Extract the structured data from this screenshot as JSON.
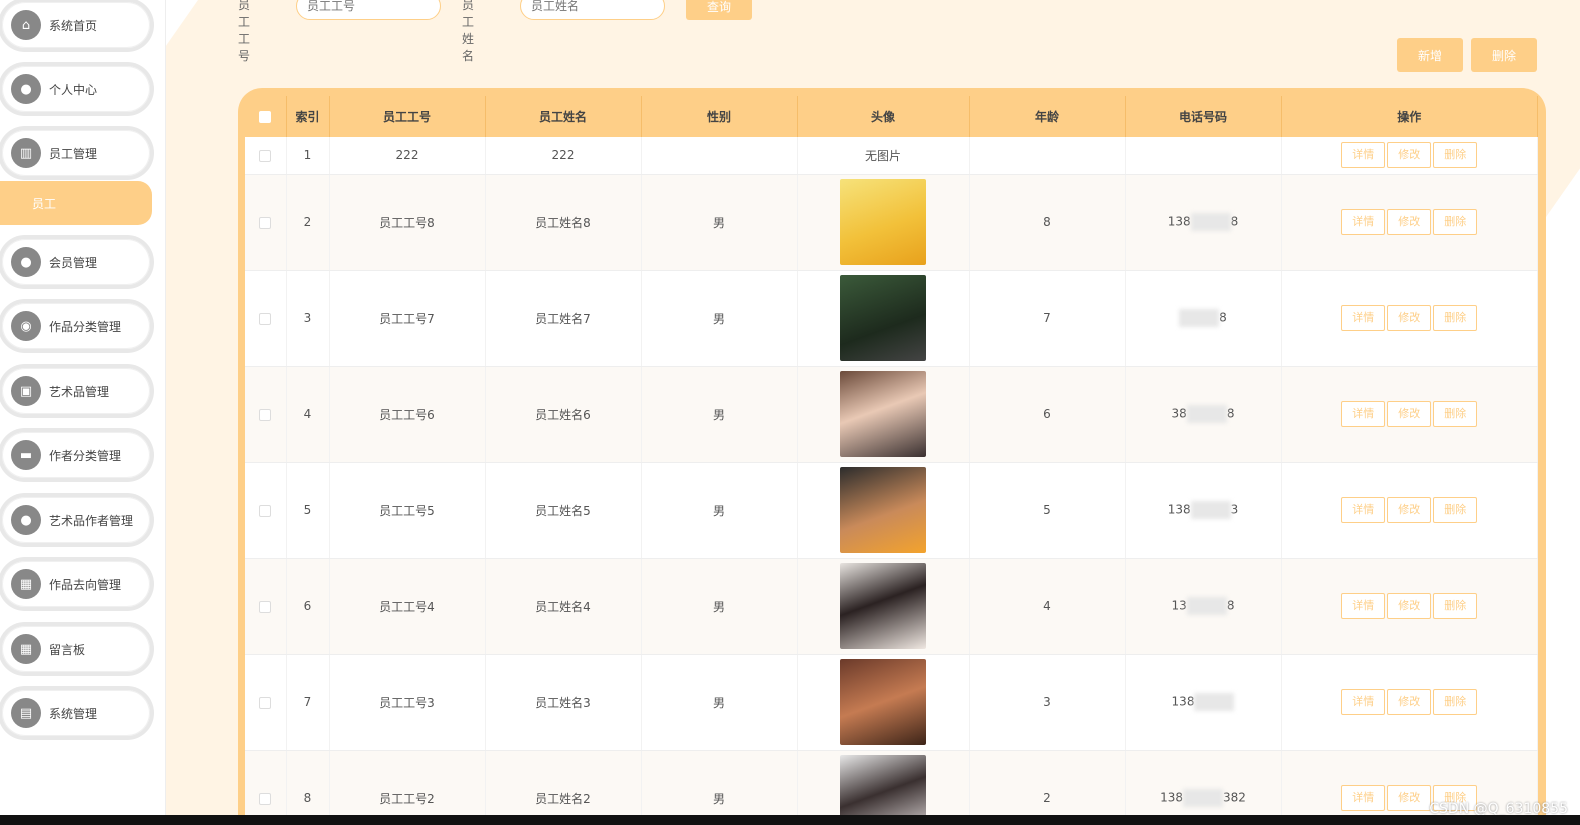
{
  "sidebar": {
    "items": [
      {
        "label": "系统首页",
        "icon": "home-icon",
        "glyph": "⌂"
      },
      {
        "label": "个人中心",
        "icon": "user-icon",
        "glyph": "●"
      },
      {
        "label": "员工管理",
        "icon": "grid-icon",
        "glyph": "▥"
      },
      {
        "label": "会员管理",
        "icon": "user-icon",
        "glyph": "●"
      },
      {
        "label": "作品分类管理",
        "icon": "pin-icon",
        "glyph": "◉"
      },
      {
        "label": "艺术品管理",
        "icon": "bag-icon",
        "glyph": "▣"
      },
      {
        "label": "作者分类管理",
        "icon": "ticket-icon",
        "glyph": "▬"
      },
      {
        "label": "艺术品作者管理",
        "icon": "user-icon",
        "glyph": "●"
      },
      {
        "label": "作品去向管理",
        "icon": "apps-icon",
        "glyph": "▦"
      },
      {
        "label": "留言板",
        "icon": "apps-icon",
        "glyph": "▦"
      },
      {
        "label": "系统管理",
        "icon": "doc-icon",
        "glyph": "▤"
      }
    ],
    "sub_item": "员工"
  },
  "search": {
    "label1": "员工工号",
    "placeholder1": "员工工号",
    "label2": "员工姓名",
    "placeholder2": "员工姓名",
    "button": "查询"
  },
  "toolbar": {
    "add": "新增",
    "delete": "删除"
  },
  "table": {
    "headers": [
      "索引",
      "员工工号",
      "员工姓名",
      "性别",
      "头像",
      "年龄",
      "电话号码",
      "操作"
    ],
    "no_image": "无图片",
    "ops": [
      "详情",
      "修改",
      "删除"
    ],
    "rows": [
      {
        "index": "1",
        "no": "222",
        "name": "222",
        "gender": "",
        "age": "",
        "phone": ""
      },
      {
        "index": "2",
        "no": "员工工号8",
        "name": "员工姓名8",
        "gender": "男",
        "age": "8",
        "phone": "138",
        "phone_end": "8"
      },
      {
        "index": "3",
        "no": "员工工号7",
        "name": "员工姓名7",
        "gender": "男",
        "age": "7",
        "phone": "",
        "phone_end": "8"
      },
      {
        "index": "4",
        "no": "员工工号6",
        "name": "员工姓名6",
        "gender": "男",
        "age": "6",
        "phone": "38",
        "phone_end": "8"
      },
      {
        "index": "5",
        "no": "员工工号5",
        "name": "员工姓名5",
        "gender": "男",
        "age": "5",
        "phone": "138",
        "phone_end": "3"
      },
      {
        "index": "6",
        "no": "员工工号4",
        "name": "员工姓名4",
        "gender": "男",
        "age": "4",
        "phone": "13",
        "phone_end": "8"
      },
      {
        "index": "7",
        "no": "员工工号3",
        "name": "员工姓名3",
        "gender": "男",
        "age": "3",
        "phone": "138",
        "phone_end": ""
      },
      {
        "index": "8",
        "no": "员工工号2",
        "name": "员工姓名2",
        "gender": "男",
        "age": "2",
        "phone": "138",
        "phone_end": "382"
      }
    ]
  },
  "watermark": "CSDN @Q_6310855",
  "colors": {
    "accent": "#fecf88",
    "bg": "#fff4e4"
  }
}
